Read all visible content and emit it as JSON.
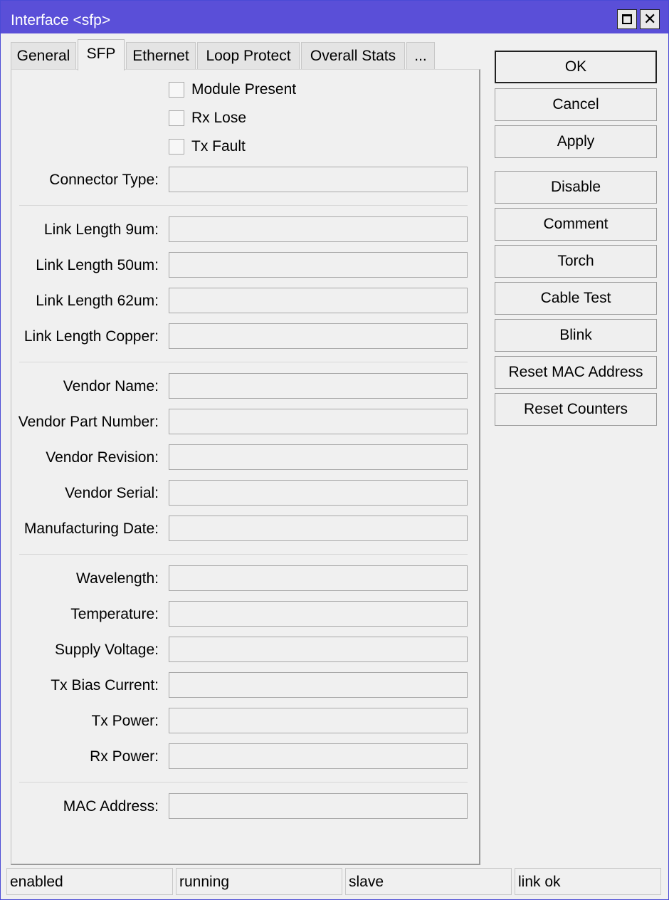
{
  "window": {
    "title": "Interface <sfp>"
  },
  "tabs": [
    {
      "label": "General"
    },
    {
      "label": "SFP"
    },
    {
      "label": "Ethernet"
    },
    {
      "label": "Loop Protect"
    },
    {
      "label": "Overall Stats"
    },
    {
      "label": "..."
    }
  ],
  "checkboxes": [
    {
      "label": "Module Present",
      "checked": false
    },
    {
      "label": "Rx Lose",
      "checked": false
    },
    {
      "label": "Tx Fault",
      "checked": false
    }
  ],
  "fields": {
    "connector_type": {
      "label": "Connector Type:",
      "value": ""
    },
    "link_length_9um": {
      "label": "Link Length 9um:",
      "value": ""
    },
    "link_length_50um": {
      "label": "Link Length 50um:",
      "value": ""
    },
    "link_length_62um": {
      "label": "Link Length 62um:",
      "value": ""
    },
    "link_length_copper": {
      "label": "Link Length Copper:",
      "value": ""
    },
    "vendor_name": {
      "label": "Vendor Name:",
      "value": ""
    },
    "vendor_part_number": {
      "label": "Vendor Part Number:",
      "value": ""
    },
    "vendor_revision": {
      "label": "Vendor Revision:",
      "value": ""
    },
    "vendor_serial": {
      "label": "Vendor Serial:",
      "value": ""
    },
    "manufacturing_date": {
      "label": "Manufacturing Date:",
      "value": ""
    },
    "wavelength": {
      "label": "Wavelength:",
      "value": ""
    },
    "temperature": {
      "label": "Temperature:",
      "value": ""
    },
    "supply_voltage": {
      "label": "Supply Voltage:",
      "value": ""
    },
    "tx_bias_current": {
      "label": "Tx Bias Current:",
      "value": ""
    },
    "tx_power": {
      "label": "Tx Power:",
      "value": ""
    },
    "rx_power": {
      "label": "Rx Power:",
      "value": ""
    },
    "mac_address": {
      "label": "MAC Address:",
      "value": ""
    }
  },
  "buttons": {
    "ok": "OK",
    "cancel": "Cancel",
    "apply": "Apply",
    "disable": "Disable",
    "comment": "Comment",
    "torch": "Torch",
    "cable_test": "Cable Test",
    "blink": "Blink",
    "reset_mac": "Reset MAC Address",
    "reset_counters": "Reset Counters"
  },
  "status_bar": [
    "enabled",
    "running",
    "slave",
    "link ok"
  ],
  "colors": {
    "titlebar": "#5a4fd8",
    "background": "#f0f0f0"
  }
}
